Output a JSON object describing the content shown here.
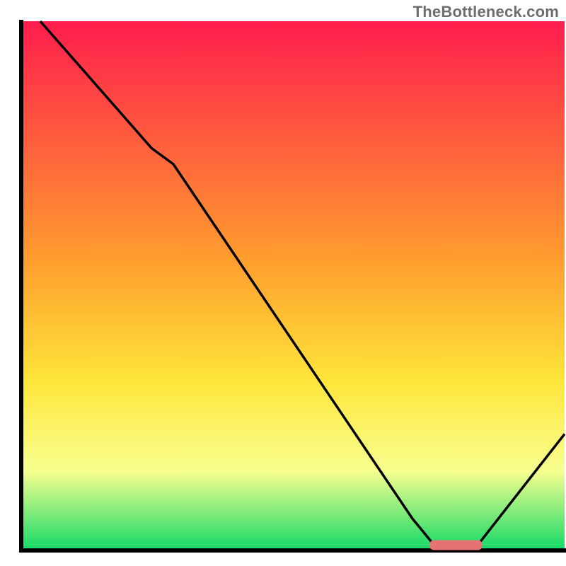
{
  "watermark": "TheBottleneck.com",
  "chart_data": {
    "type": "line",
    "title": "",
    "xlabel": "",
    "ylabel": "",
    "xlim": [
      0,
      100
    ],
    "ylim": [
      0,
      100
    ],
    "gradient_colors": {
      "top": "#ff1d4d",
      "mid_upper": "#ff9d2e",
      "mid": "#ffe63a",
      "mid_lower": "#f7ff8f",
      "bottom": "#13d967"
    },
    "curve": [
      {
        "x": 3.5,
        "y": 100
      },
      {
        "x": 24,
        "y": 76
      },
      {
        "x": 28,
        "y": 73
      },
      {
        "x": 72,
        "y": 6
      },
      {
        "x": 76,
        "y": 1
      },
      {
        "x": 84,
        "y": 1
      },
      {
        "x": 100,
        "y": 22
      }
    ],
    "marker_segment": {
      "x_start": 76,
      "x_end": 84,
      "y": 1,
      "color": "#e57373"
    }
  }
}
